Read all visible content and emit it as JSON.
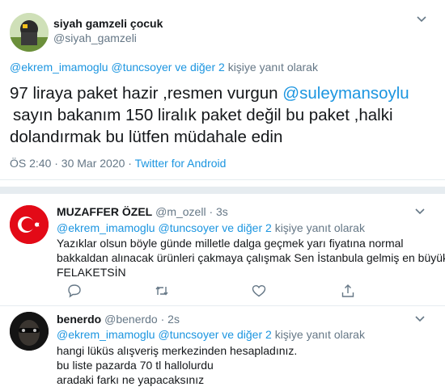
{
  "main_tweet": {
    "display_name": "siyah gamzeli çocuk",
    "handle": "@siyah_gamzeli",
    "reply_to": {
      "mention1": "@ekrem_imamoglu",
      "mention2": "@tuncsoyer",
      "connector": "ve",
      "others": "diğer 2",
      "suffix": "kişiye yanıt olarak"
    },
    "text_part1": "97 liraya paket hazir ,resmen vurgun",
    "mention": "@suleymansoylu",
    "text_line2": "sayın bakanım 150 liralık paket değil bu paket ,halki",
    "text_line3": "dolandırmak bu lütfen müdahale edin",
    "time": "ÖS 2:40 · 30 Mar 2020 ·",
    "source": "Twitter for Android"
  },
  "replies": [
    {
      "display_name": "MUZAFFER ÖZEL",
      "handle": "@m_ozell",
      "age": "· 3s",
      "reply_to": {
        "mention1": "@ekrem_imamoglu",
        "mention2": "@tuncsoyer",
        "connector": "ve",
        "others": "diğer 2",
        "suffix": "kişiye yanıt olarak"
      },
      "lines": [
        "Yazıklar olsun böyle günde milletle dalga geçmek yarı fiyatına normal",
        "bakkaldan alınacak ürünleri çakmaya çalışmak Sen İstanbula gelmiş en büyük",
        "FELAKETSİN"
      ]
    },
    {
      "display_name": "benerdo",
      "handle": "@benerdo",
      "age": "· 2s",
      "reply_to": {
        "mention1": "@ekrem_imamoglu",
        "mention2": "@tuncsoyer",
        "connector": "ve",
        "others": "diğer 2",
        "suffix": "kişiye yanıt olarak"
      },
      "lines": [
        "hangi lüküs alışveriş merkezinden hesapladınız.",
        "bu liste pazarda 70 tl hallolurdu",
        "aradaki farkı ne yapacaksınız"
      ]
    }
  ],
  "colors": {
    "link": "#1b95e0",
    "muted": "#657786",
    "divider": "#e6ecf0",
    "flag_red": "#e30a17"
  }
}
